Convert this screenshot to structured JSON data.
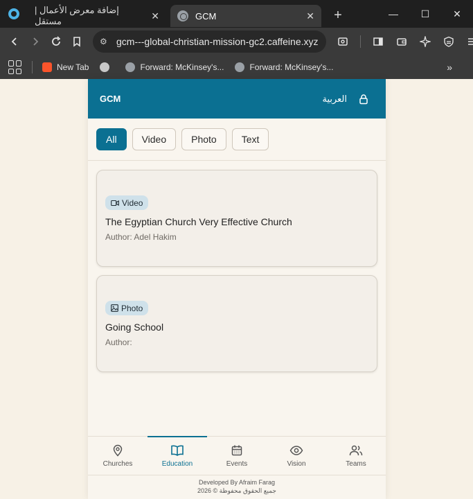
{
  "browser": {
    "tabs": [
      {
        "title": "إضافة معرض الأعمال | مستقل",
        "active": false
      },
      {
        "title": "GCM",
        "active": true
      }
    ],
    "url": "gcm---global-christian-mission-gc2.caffeine.xyz",
    "bookmarks": [
      {
        "label": "New Tab",
        "icon": "brave-icon"
      },
      {
        "label": "",
        "icon": "circle-icon"
      },
      {
        "label": "Forward: McKinsey's...",
        "icon": "globe-icon"
      },
      {
        "label": "Forward: McKinsey's...",
        "icon": "globe-icon"
      }
    ]
  },
  "app": {
    "brand": "GCM",
    "language_toggle": "العربية",
    "accent_color": "#0b7092",
    "filters": [
      "All",
      "Video",
      "Photo",
      "Text"
    ],
    "active_filter": "All",
    "cards": [
      {
        "type": "Video",
        "title": "The Egyptian Church Very Effective Church",
        "author": "Author: Adel Hakim"
      },
      {
        "type": "Photo",
        "title": "Going School",
        "author": "Author:"
      }
    ],
    "nav": [
      {
        "label": "Churches",
        "icon": "map-pin-icon"
      },
      {
        "label": "Education",
        "icon": "book-open-icon"
      },
      {
        "label": "Events",
        "icon": "calendar-icon"
      },
      {
        "label": "Vision",
        "icon": "eye-icon"
      },
      {
        "label": "Teams",
        "icon": "users-icon"
      }
    ],
    "active_nav": "Education",
    "footer": {
      "line1": "Developed By Afraim Farag",
      "line2": "جميع الحقوق محفوظة © 2026"
    }
  }
}
